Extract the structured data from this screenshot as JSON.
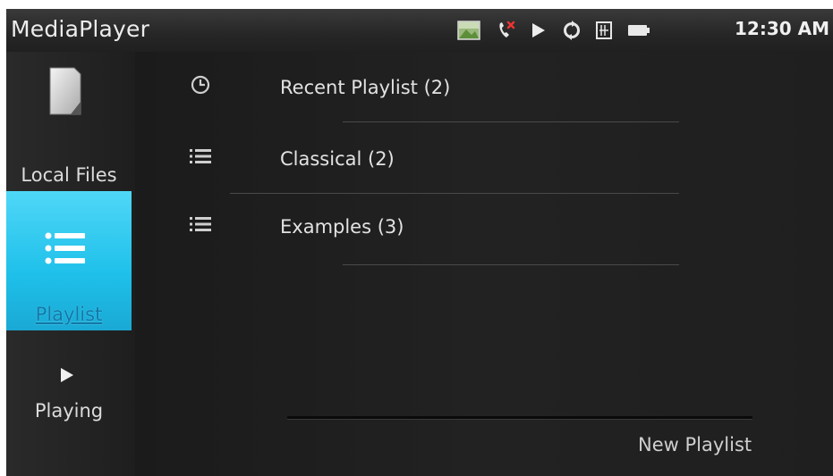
{
  "app": {
    "title": "MediaPlayer"
  },
  "status_bar": {
    "time": "12:30 AM",
    "icons": [
      "gallery-icon",
      "missed-call-icon",
      "play-icon",
      "sync-icon",
      "sd-card-icon",
      "battery-icon"
    ]
  },
  "sidebar": {
    "items": [
      {
        "label": "Local Files",
        "icon": "file-icon",
        "selected": false
      },
      {
        "label": "Playlist",
        "icon": "list-icon",
        "selected": true
      },
      {
        "label": "Playing",
        "icon": "play-icon",
        "selected": false
      }
    ]
  },
  "playlists": [
    {
      "label": "Recent Playlist  (2)",
      "icon": "clock-icon"
    },
    {
      "label": "Classical  (2)",
      "icon": "list-icon"
    },
    {
      "label": "Examples  (3)",
      "icon": "list-icon"
    }
  ],
  "actions": {
    "new_playlist": "New Playlist"
  },
  "colors": {
    "accent": "#1ec0ea",
    "background": "#1d1d1d",
    "text": "#e2e2e2"
  }
}
